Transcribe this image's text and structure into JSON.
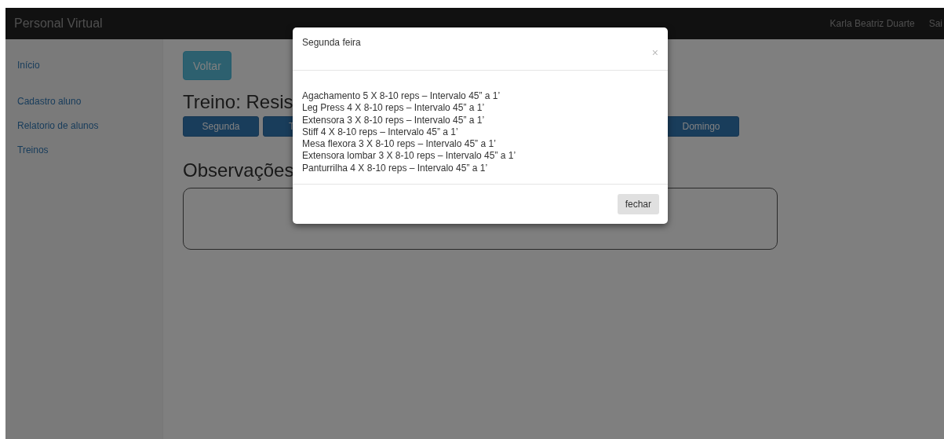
{
  "navbar": {
    "brand": "Personal Virtual",
    "user": "Karla Beatriz Duarte",
    "logout": "Sai"
  },
  "sidebar": {
    "items": [
      {
        "label": "Início"
      },
      {
        "label": "Cadastro aluno"
      },
      {
        "label": "Relatorio de alunos"
      },
      {
        "label": "Treinos"
      }
    ]
  },
  "back_button": "Voltar",
  "title": "Treino: Resis",
  "days": [
    {
      "label": "Segunda",
      "kind": "full"
    },
    {
      "label": "T",
      "kind": "cut"
    },
    {
      "label": "Domingo",
      "kind": "end"
    }
  ],
  "notes": {
    "title": "Observações"
  },
  "modal": {
    "title": "Segunda feira",
    "close": "×",
    "lines": [
      "Agachamento 5 X 8-10 reps – Intervalo 45” a 1’",
      "Leg Press 4 X 8-10 reps – Intervalo 45” a 1’",
      "Extensora 3 X 8-10 reps – Intervalo 45” a 1’",
      "Stiff 4 X 8-10 reps – Intervalo 45” a 1’",
      "Mesa flexora 3 X 8-10 reps – Intervalo 45” a 1’",
      "Extensora lombar 3 X 8-10 reps – Intervalo 45” a 1’",
      "Panturrilha 4 X 8-10 reps – Intervalo 45” a 1’"
    ],
    "button": "fechar"
  }
}
